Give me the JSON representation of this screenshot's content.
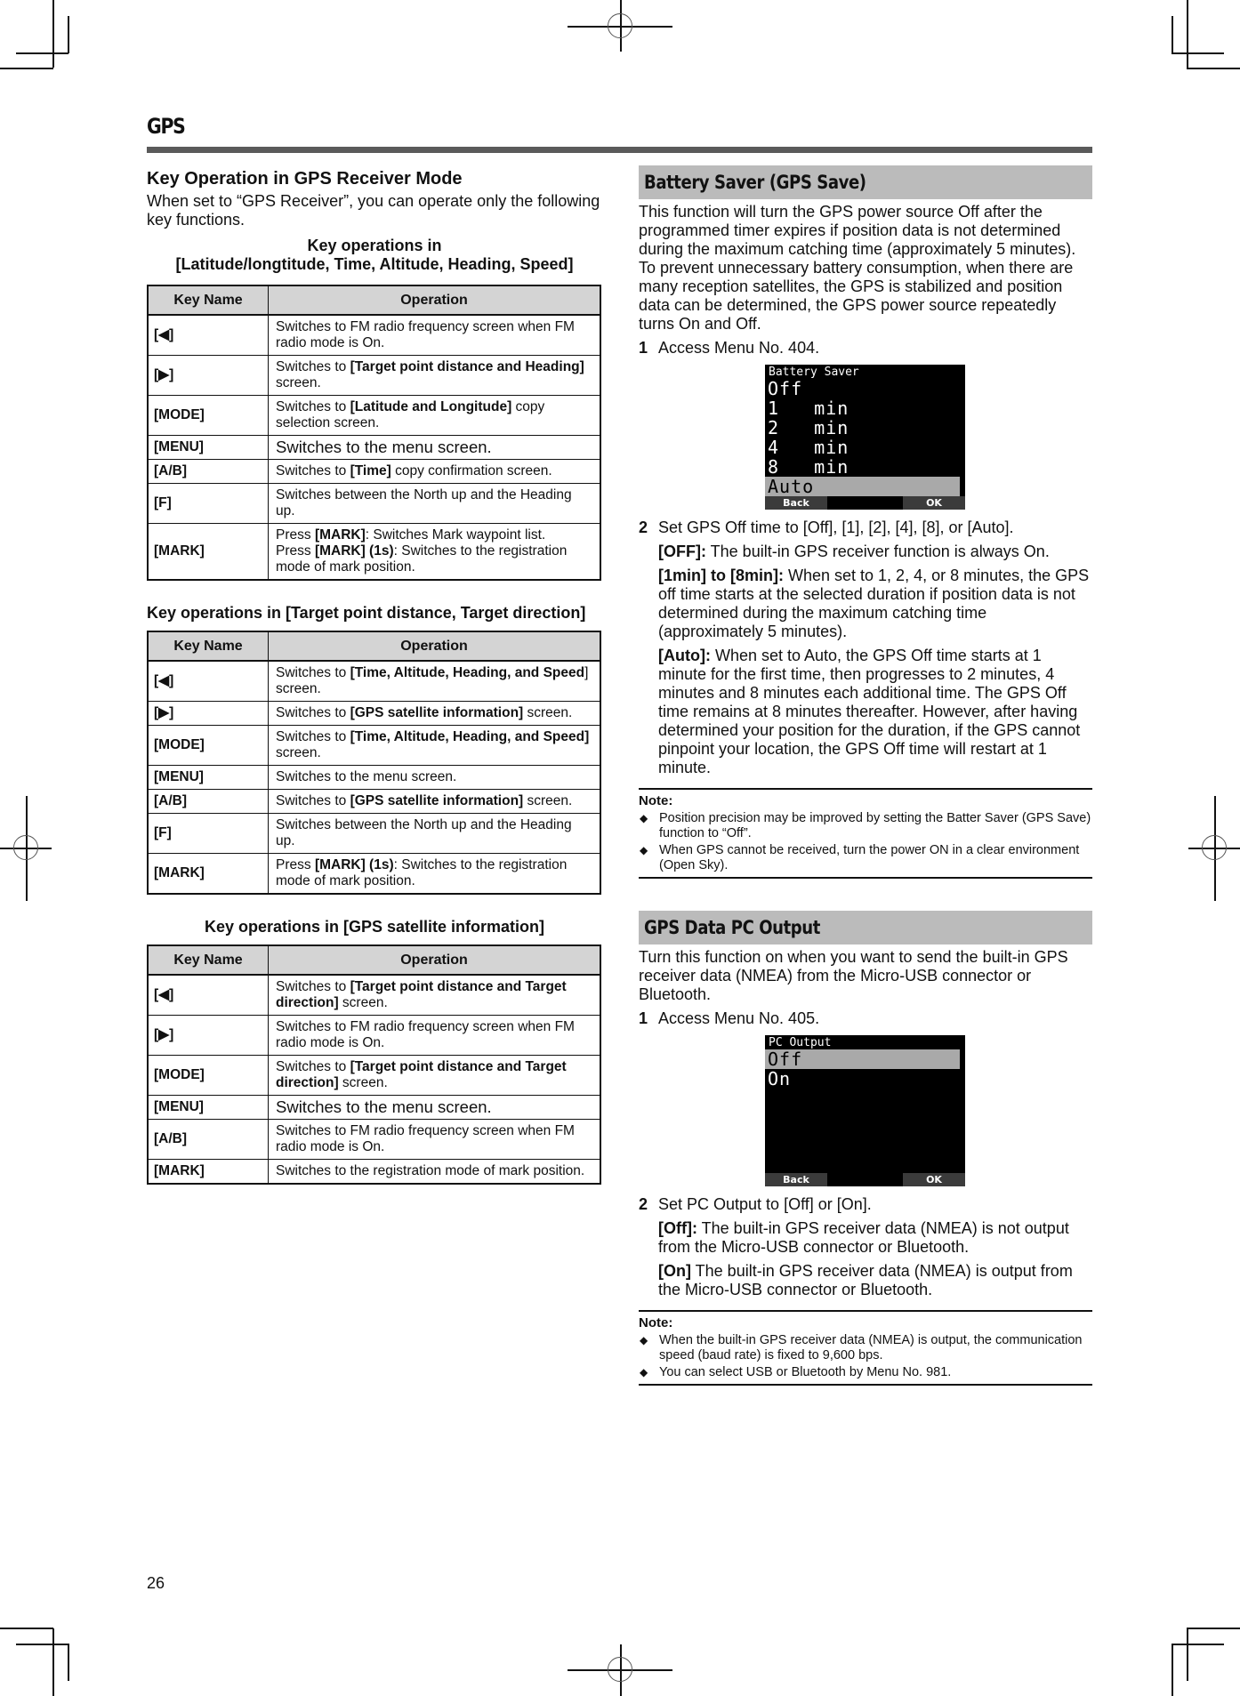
{
  "page": {
    "chapter_title": "GPS",
    "page_number": "26"
  },
  "left": {
    "heading": "Key Operation in GPS Receiver Mode",
    "intro": "When set to “GPS Receiver”, you can operate only the following key functions.",
    "column_headers": {
      "key": "Key Name",
      "operation": "Operation"
    },
    "tables": [
      {
        "caption_line1": "Key operations in",
        "caption_line2": "[Latitude/longtitude, Time, Altitude,  Heading, Speed]",
        "rows": [
          {
            "key": "[◀]",
            "op": [
              {
                "t": "Switches to FM radio frequency screen when FM radio mode is On."
              }
            ]
          },
          {
            "key": "[▶]",
            "op": [
              {
                "t": "Switches to "
              },
              {
                "b": "[Target point distance and Heading]"
              },
              {
                "t": " screen."
              }
            ]
          },
          {
            "key": "[MODE]",
            "op": [
              {
                "t": "Switches to "
              },
              {
                "b": "[Latitude and Longitude]"
              },
              {
                "t": " copy selection screen."
              }
            ]
          },
          {
            "key": "[MENU]",
            "op": [
              {
                "t": "Switches to the menu screen."
              }
            ],
            "large": true
          },
          {
            "key": "[A/B]",
            "op": [
              {
                "t": "Switches to "
              },
              {
                "b": "[Time]"
              },
              {
                "t": " copy confirmation screen."
              }
            ]
          },
          {
            "key": "[F]",
            "op": [
              {
                "t": "Switches between the North up and the Heading up."
              }
            ]
          },
          {
            "key": "[MARK]",
            "op": [
              {
                "t": "Press "
              },
              {
                "b": "[MARK]"
              },
              {
                "t": ": Switches Mark waypoint list."
              },
              {
                "br": true
              },
              {
                "t": "Press "
              },
              {
                "b": "[MARK] (1s)"
              },
              {
                "t": ": Switches to the registration mode of mark position."
              }
            ]
          }
        ]
      },
      {
        "caption_line1": "Key operations in [Target point distance, Target direction]",
        "rows": [
          {
            "key": "[◀]",
            "op": [
              {
                "t": "Switches to "
              },
              {
                "b": "[Time, Altitude, Heading, and Speed"
              },
              {
                "t": "] screen."
              }
            ]
          },
          {
            "key": "[▶]",
            "op": [
              {
                "t": "Switches to "
              },
              {
                "b": "[GPS satellite information]"
              },
              {
                "t": " screen."
              }
            ]
          },
          {
            "key": "[MODE]",
            "op": [
              {
                "t": "Switches to "
              },
              {
                "b": "[Time, Altitude, Heading, and Speed]"
              },
              {
                "t": " screen."
              }
            ]
          },
          {
            "key": "[MENU]",
            "op": [
              {
                "t": "Switches to the menu screen."
              }
            ]
          },
          {
            "key": "[A/B]",
            "op": [
              {
                "t": "Switches to "
              },
              {
                "b": "[GPS satellite information]"
              },
              {
                "t": " screen."
              }
            ]
          },
          {
            "key": "[F]",
            "op": [
              {
                "t": "Switches between the North up and the Heading up."
              }
            ]
          },
          {
            "key": "[MARK]",
            "op": [
              {
                "t": "Press "
              },
              {
                "b": "[MARK] (1s)"
              },
              {
                "t": ": Switches to the registration mode of mark position."
              }
            ]
          }
        ]
      },
      {
        "caption_line1": "Key operations in [GPS satellite information]",
        "rows": [
          {
            "key": "[◀]",
            "op": [
              {
                "t": "Switches to "
              },
              {
                "b": "[Target point distance and Target direction]"
              },
              {
                "t": " screen."
              }
            ]
          },
          {
            "key": "[▶]",
            "op": [
              {
                "t": "Switches to FM radio frequency screen when FM radio mode is On."
              }
            ]
          },
          {
            "key": "[MODE]",
            "op": [
              {
                "t": "Switches to "
              },
              {
                "b": "[Target point distance and Target direction]"
              },
              {
                "t": " screen."
              }
            ]
          },
          {
            "key": "[MENU]",
            "op": [
              {
                "t": "Switches to the menu screen."
              }
            ],
            "large": true
          },
          {
            "key": "[A/B]",
            "op": [
              {
                "t": "Switches to FM radio frequency screen when FM radio mode is On."
              }
            ]
          },
          {
            "key": "[MARK]",
            "op": [
              {
                "t": "Switches to the registration mode of mark position."
              }
            ]
          }
        ]
      }
    ]
  },
  "battery_saver": {
    "heading": "Battery Saver (GPS Save)",
    "description": "This function will turn the GPS power source Off after the programmed timer expires if position data is not determined during the maximum catching time (approximately 5 minutes). To prevent unnecessary battery consumption, when there are many reception satellites, the GPS is stabilized and position data can be determined, the GPS power source repeatedly turns On and Off.",
    "step1_num": "1",
    "step1": "Access Menu No. 404.",
    "lcd": {
      "title": "Battery Saver",
      "items": [
        "Off",
        "1   min",
        "2   min",
        "4   min",
        "8   min",
        "Auto"
      ],
      "selected": "Auto",
      "softkey_left": "Back",
      "softkey_right": "OK"
    },
    "step2_num": "2",
    "step2": "Set GPS Off time to [Off], [1], [2], [4], [8], or [Auto].",
    "options": [
      {
        "label": "[OFF]:",
        "text": " The built-in GPS receiver function is always On."
      },
      {
        "label": "[1min] to [8min]:",
        "text": " When set to 1, 2, 4, or 8 minutes, the GPS off time starts at the selected duration if position data is not determined during the maximum catching time (approximately 5 minutes)."
      },
      {
        "label": "[Auto]:",
        "text": " When set to Auto, the GPS Off time starts at 1 minute for the first time, then progresses to 2 minutes, 4 minutes and 8 minutes each additional time. The GPS Off time remains at 8 minutes thereafter. However, after having determined your position for the duration, if the GPS cannot pinpoint your location, the GPS Off time will restart at 1 minute."
      }
    ],
    "note_title": "Note:",
    "notes": [
      "Position precision may be improved by setting the Batter Saver (GPS Save) function to “Off”.",
      "When GPS cannot be received, turn the power ON in a clear environment (Open Sky)."
    ]
  },
  "pc_output": {
    "heading": "GPS Data PC Output",
    "description": "Turn this function on when you want to send the built-in GPS receiver data (NMEA) from the Micro-USB connector or Bluetooth.",
    "step1_num": "1",
    "step1": "Access Menu No. 405.",
    "lcd": {
      "title": "PC Output",
      "items": [
        "Off",
        "On"
      ],
      "selected": "Off",
      "softkey_left": "Back",
      "softkey_right": "OK"
    },
    "step2_num": "2",
    "step2": "Set PC Output to [Off] or [On].",
    "options": [
      {
        "label": "[Off]:",
        "text": " The built-in GPS receiver data (NMEA) is not output from the Micro-USB connector or Bluetooth."
      },
      {
        "label": "[On]",
        "text": " The built-in GPS receiver data (NMEA) is output from the Micro-USB connector or Bluetooth."
      }
    ],
    "note_title": "Note:",
    "notes": [
      "When the built-in GPS receiver data (NMEA) is output, the communication speed (baud rate) is fixed to 9,600 bps.",
      "You can select USB or Bluetooth by Menu No. 981."
    ]
  },
  "icons": {
    "bullet": "◆"
  }
}
